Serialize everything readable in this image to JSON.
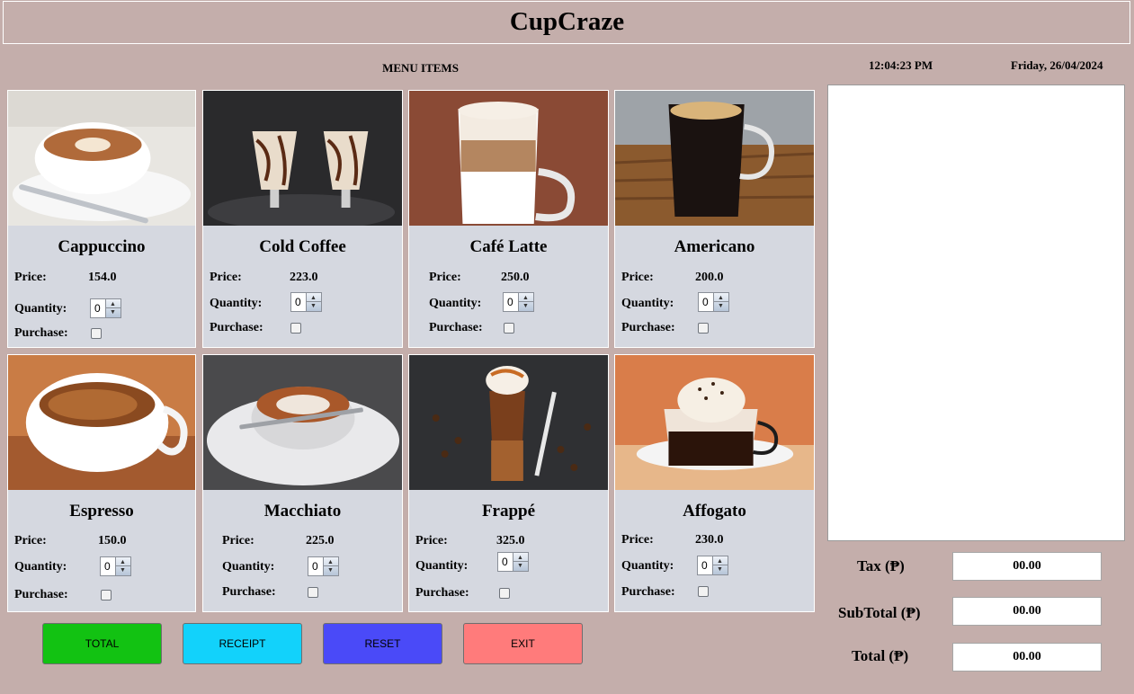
{
  "app": {
    "title": "CupCraze"
  },
  "menu": {
    "title": "MENU ITEMS"
  },
  "clock": {
    "time": "12:04:23 PM",
    "date": "Friday, 26/04/2024"
  },
  "labels": {
    "price": "Price:",
    "quantity": "Quantity:",
    "purchase": "Purchase:"
  },
  "items": [
    {
      "name": "Cappuccino",
      "price": "154.0",
      "quantity": "0",
      "purchased": false
    },
    {
      "name": "Cold Coffee",
      "price": "223.0",
      "quantity": "0",
      "purchased": false
    },
    {
      "name": "Café Latte",
      "price": "250.0",
      "quantity": "0",
      "purchased": false
    },
    {
      "name": "Americano",
      "price": "200.0",
      "quantity": "0",
      "purchased": false
    },
    {
      "name": "Espresso",
      "price": "150.0",
      "quantity": "0",
      "purchased": false
    },
    {
      "name": "Macchiato",
      "price": "225.0",
      "quantity": "0",
      "purchased": false
    },
    {
      "name": "Frappé",
      "price": "325.0",
      "quantity": "0",
      "purchased": false
    },
    {
      "name": "Affogato",
      "price": "230.0",
      "quantity": "0",
      "purchased": false
    }
  ],
  "buttons": {
    "total": {
      "label": "TOTAL",
      "color": "#12c212"
    },
    "receipt": {
      "label": "RECEIPT",
      "color": "#12d2fb"
    },
    "reset": {
      "label": "RESET",
      "color": "#4a4af8"
    },
    "exit": {
      "label": "EXIT",
      "color": "#ff7b7b"
    }
  },
  "summary": {
    "tax_label": "Tax (₱)",
    "tax_value": "00.00",
    "subtotal_label": "SubTotal (₱)",
    "subtotal_value": "00.00",
    "total_label": "Total (₱)",
    "total_value": "00.00"
  },
  "colors": {
    "background": "#c4aeab",
    "card": "#d5d8e0"
  }
}
